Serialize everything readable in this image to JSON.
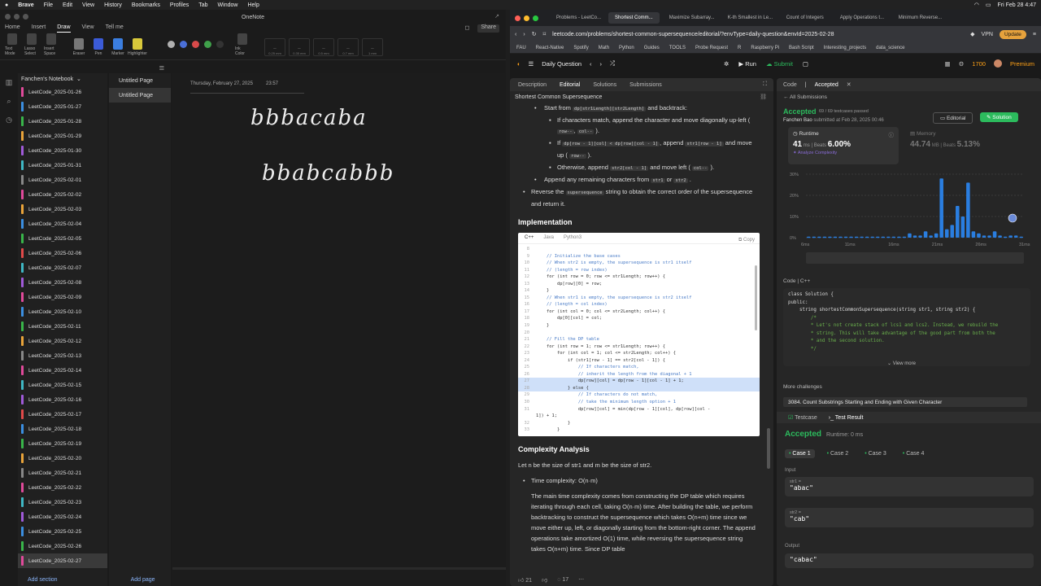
{
  "menubar": {
    "apple": "",
    "app": "Brave",
    "items": [
      "File",
      "Edit",
      "View",
      "History",
      "Bookmarks",
      "Profiles",
      "Tab",
      "Window",
      "Help"
    ],
    "datetime": "Fri Feb 28 4:47"
  },
  "onenote": {
    "title": "OneNote",
    "tabs": [
      "Home",
      "Insert",
      "Draw",
      "View",
      "Tell me"
    ],
    "active_tab": "Draw",
    "tools": [
      "Text Mode",
      "Lasso Select",
      "Insert Space",
      "Eraser",
      "Pen",
      "Marker",
      "Highlighter",
      "Ink Color"
    ],
    "pen_sizes": [
      "0.25 mm",
      "0.35 mm",
      "0.5 mm",
      "0.7 mm",
      "1 mm"
    ],
    "swatches": [
      "#b0b0b0",
      "#4a6fd8",
      "#d84a4a",
      "#3fa04a",
      "#333333"
    ],
    "share": "Share",
    "notebook": "Fanchen's Notebook",
    "sections": [
      {
        "name": "LeetCode_2025-01-26",
        "color": "#e04a9a"
      },
      {
        "name": "LeetCode_2025-01-27",
        "color": "#3b8ee0"
      },
      {
        "name": "LeetCode_2025-01-28",
        "color": "#39b54a"
      },
      {
        "name": "LeetCode_2025-01-29",
        "color": "#e8a33a"
      },
      {
        "name": "LeetCode_2025-01-30",
        "color": "#a05ad8"
      },
      {
        "name": "LeetCode_2025-01-31",
        "color": "#3fb7c4"
      },
      {
        "name": "LeetCode_2025-02-01",
        "color": "#888888"
      },
      {
        "name": "LeetCode_2025-02-02",
        "color": "#e04a9a"
      },
      {
        "name": "LeetCode_2025-02-03",
        "color": "#e8a33a"
      },
      {
        "name": "LeetCode_2025-02-04",
        "color": "#3b8ee0"
      },
      {
        "name": "LeetCode_2025-02-05",
        "color": "#39b54a"
      },
      {
        "name": "LeetCode_2025-02-06",
        "color": "#e04a4a"
      },
      {
        "name": "LeetCode_2025-02-07",
        "color": "#3fb7c4"
      },
      {
        "name": "LeetCode_2025-02-08",
        "color": "#a05ad8"
      },
      {
        "name": "LeetCode_2025-02-09",
        "color": "#e04a9a"
      },
      {
        "name": "LeetCode_2025-02-10",
        "color": "#3b8ee0"
      },
      {
        "name": "LeetCode_2025-02-11",
        "color": "#39b54a"
      },
      {
        "name": "LeetCode_2025-02-12",
        "color": "#e8a33a"
      },
      {
        "name": "LeetCode_2025-02-13",
        "color": "#888888"
      },
      {
        "name": "LeetCode_2025-02-14",
        "color": "#e04a9a"
      },
      {
        "name": "LeetCode_2025-02-15",
        "color": "#3fb7c4"
      },
      {
        "name": "LeetCode_2025-02-16",
        "color": "#a05ad8"
      },
      {
        "name": "LeetCode_2025-02-17",
        "color": "#e04a4a"
      },
      {
        "name": "LeetCode_2025-02-18",
        "color": "#3b8ee0"
      },
      {
        "name": "LeetCode_2025-02-19",
        "color": "#39b54a"
      },
      {
        "name": "LeetCode_2025-02-20",
        "color": "#e8a33a"
      },
      {
        "name": "LeetCode_2025-02-21",
        "color": "#888888"
      },
      {
        "name": "LeetCode_2025-02-22",
        "color": "#e04a9a"
      },
      {
        "name": "LeetCode_2025-02-23",
        "color": "#3fb7c4"
      },
      {
        "name": "LeetCode_2025-02-24",
        "color": "#a05ad8"
      },
      {
        "name": "LeetCode_2025-02-25",
        "color": "#3b8ee0"
      },
      {
        "name": "LeetCode_2025-02-26",
        "color": "#39b54a"
      },
      {
        "name": "LeetCode_2025-02-27",
        "color": "#e04a9a"
      }
    ],
    "selected_section": "LeetCode_2025-02-27",
    "pages": [
      "Untitled Page",
      "Untitled Page"
    ],
    "selected_page_index": 1,
    "page_date": "Thursday, February 27, 2025",
    "page_time": "23:57",
    "ink_line1": "bbbacaba",
    "ink_line2": "bbabcabbb",
    "add_section": "Add section",
    "add_page": "Add page"
  },
  "browser": {
    "tabs": [
      "Problems - LeetCo...",
      "Shortest Comm...",
      "Maximize Subarray...",
      "K-th Smallest in Le...",
      "Count of Integers",
      "Apply Operations t...",
      "Minimum Reverse..."
    ],
    "active_tab_index": 1,
    "url": "leetcode.com/problems/shortest-common-supersequence/editorial/?envType=daily-question&envId=2025-02-28",
    "vpn": "VPN",
    "update": "Update",
    "bookmarks": [
      "FAU",
      "React-Native",
      "Spotify",
      "Math",
      "Python",
      "Guides",
      "TOOLS",
      "Probe Request",
      "R",
      "Raspberry Pi",
      "Bash Script",
      "Interesting_projects",
      "data_science"
    ]
  },
  "lc": {
    "nav": {
      "daily": "Daily Question",
      "run": "Run",
      "submit": "Submit",
      "points": "1700",
      "premium": "Premium"
    },
    "left_tabs": [
      "Description",
      "Editorial",
      "Solutions",
      "Submissions"
    ],
    "active_left_tab": "Editorial",
    "problem_title": "Shortest Common Supersequence",
    "article": {
      "start_from": "Start from",
      "start_chip": "dp[str1Length][str2Length]",
      "and_backtrack": "and backtrack:",
      "match": "If characters match, append the character and move diagonally up-left (",
      "match_chip1": "row--",
      "match_chip2": "col--",
      "if_word": "If",
      "if_chip": "dp[row - 1][col] < dp[row][col - 1]",
      "append_word": ", append",
      "append_chip": "str1[row - 1]",
      "and_word": "and",
      "move_up": "move up (",
      "move_up_chip": "row--",
      "otherwise": "Otherwise, append",
      "otherwise_chip": "str2[col - 1]",
      "move_left": "and move left (",
      "move_left_chip": "col--",
      "remaining": "Append any remaining characters from",
      "rem_chip1": "str1",
      "or_word": "or",
      "rem_chip2": "str2",
      "reverse": "Reverse the",
      "reverse_chip": "supersequence",
      "reverse_rest": "string to obtain the correct order of the supersequence and return it.",
      "impl_heading": "Implementation",
      "complexity_heading": "Complexity Analysis",
      "let_line": "Let n be the size of str1 and m be the size of str2.",
      "time_label": "Time complexity: O(n·m)",
      "time_para": "The main time complexity comes from constructing the DP table which requires iterating through each cell, taking O(n·m) time. After building the table, we perform backtracking to construct the supersequence which takes O(n+m) time since we move either up, left, or diagonally starting from the bottom-right corner. The append operations take amortized O(1) time, while reversing the supersequence string takes O(n+m) time. Since DP table"
    },
    "code_tabs": [
      "C++",
      "Java",
      "Python3"
    ],
    "copy": "Copy",
    "code_lines": [
      {
        "n": "8",
        "t": ""
      },
      {
        "n": "9",
        "t": "    // Initialize the base cases",
        "c": true
      },
      {
        "n": "10",
        "t": "    // When str2 is empty, the supersequence is str1 itself",
        "c": true
      },
      {
        "n": "11",
        "t": "    // (length = row index)",
        "c": true
      },
      {
        "n": "12",
        "t": "    for (int row = 0; row <= str1Length; row++) {"
      },
      {
        "n": "13",
        "t": "        dp[row][0] = row;"
      },
      {
        "n": "14",
        "t": "    }"
      },
      {
        "n": "15",
        "t": "    // When str1 is empty, the supersequence is str2 itself",
        "c": true
      },
      {
        "n": "16",
        "t": "    // (length = col index)",
        "c": true
      },
      {
        "n": "17",
        "t": "    for (int col = 0; col <= str2Length; col++) {"
      },
      {
        "n": "18",
        "t": "        dp[0][col] = col;"
      },
      {
        "n": "19",
        "t": "    }"
      },
      {
        "n": "20",
        "t": ""
      },
      {
        "n": "21",
        "t": "    // Fill the DP table",
        "c": true
      },
      {
        "n": "22",
        "t": "    for (int row = 1; row <= str1Length; row++) {"
      },
      {
        "n": "23",
        "t": "        for (int col = 1; col <= str2Length; col++) {"
      },
      {
        "n": "24",
        "t": "            if (str1[row - 1] == str2[col - 1]) {"
      },
      {
        "n": "25",
        "t": "                // If characters match,",
        "c": true
      },
      {
        "n": "26",
        "t": "                // inherit the length from the diagonal + 1",
        "c": true
      },
      {
        "n": "27",
        "t": "                dp[row][col] = dp[row - 1][col - 1] + 1;",
        "h": true
      },
      {
        "n": "28",
        "t": "            } else {",
        "h": true
      },
      {
        "n": "29",
        "t": "                // If characters do not match,",
        "c": true
      },
      {
        "n": "30",
        "t": "                // take the minimum length option + 1",
        "c": true
      },
      {
        "n": "31",
        "t": "                dp[row][col] = min(dp[row - 1][col], dp[row][col -"
      },
      {
        "n": "",
        "t": "1]) + 1;"
      },
      {
        "n": "32",
        "t": "            }"
      },
      {
        "n": "33",
        "t": "        }"
      }
    ],
    "footer": {
      "likes": "21",
      "comments": "17"
    },
    "right_tabs": [
      "Code",
      "Accepted"
    ],
    "all_submissions": "All Submissions",
    "accepted": "Accepted",
    "passed": "69 / 69 testcases passed",
    "submitted_by": "Fanchen Bao",
    "submitted_at": "submitted at Feb 28, 2025 00:46",
    "editorial_btn": "Editorial",
    "solution_btn": "Solution",
    "runtime_label": "Runtime",
    "runtime_val": "41",
    "runtime_unit": "ms",
    "beats_label": "Beats",
    "runtime_beats": "6.00%",
    "analyze": "Analyze Complexity",
    "memory_label": "Memory",
    "memory_val": "44.74",
    "memory_unit": "MB",
    "memory_beats": "5.13%",
    "hist_y": [
      "30%",
      "20%",
      "10%",
      "0%"
    ],
    "hist_x": [
      "6ms",
      "11ms",
      "16ms",
      "21ms",
      "26ms",
      "31ms"
    ],
    "code_label": "Code",
    "code_lang": "C++",
    "snippet": [
      "class Solution {",
      "public:",
      "    string shortestCommonSupersequence(string str1, string str2) {",
      "        /*",
      "        * Let's not create stack of lcs1 and lcs2. Instead, we rebuild the",
      "        * string. This will take advantage of the good part from both the",
      "        * and the second solution.",
      "        */"
    ],
    "view_more": "View more",
    "more_challenges": "More challenges",
    "challenge": "3084. Count Substrings Starting and Ending with Given Character",
    "test_tabs": [
      "Testcase",
      "Test Result"
    ],
    "result": "Accepted",
    "runtime_text": "Runtime: 0 ms",
    "cases": [
      "Case 1",
      "Case 2",
      "Case 3",
      "Case 4"
    ],
    "input_label": "Input",
    "str1_key": "str1 =",
    "str1_val": "\"abac\"",
    "str2_key": "str2 =",
    "str2_val": "\"cab\"",
    "output_label": "Output",
    "output_val": "\"cabac\""
  },
  "chart_data": {
    "type": "bar",
    "ylim": [
      0,
      30
    ],
    "y_ticks": [
      "0%",
      "10%",
      "20%",
      "30%"
    ],
    "x_ticks": [
      "6ms",
      "11ms",
      "16ms",
      "21ms",
      "26ms",
      "31ms"
    ],
    "values": [
      0.5,
      0.5,
      0.5,
      0.5,
      0.5,
      0.5,
      0.5,
      0.5,
      0.5,
      0.5,
      0.5,
      0.5,
      0.5,
      0.5,
      0.5,
      0.5,
      0.5,
      0.5,
      0.5,
      2,
      1,
      1,
      3,
      1,
      2,
      28,
      4,
      6,
      15,
      10,
      26,
      3,
      2,
      1,
      1,
      3,
      1,
      0.5,
      1,
      1,
      0.5
    ]
  }
}
